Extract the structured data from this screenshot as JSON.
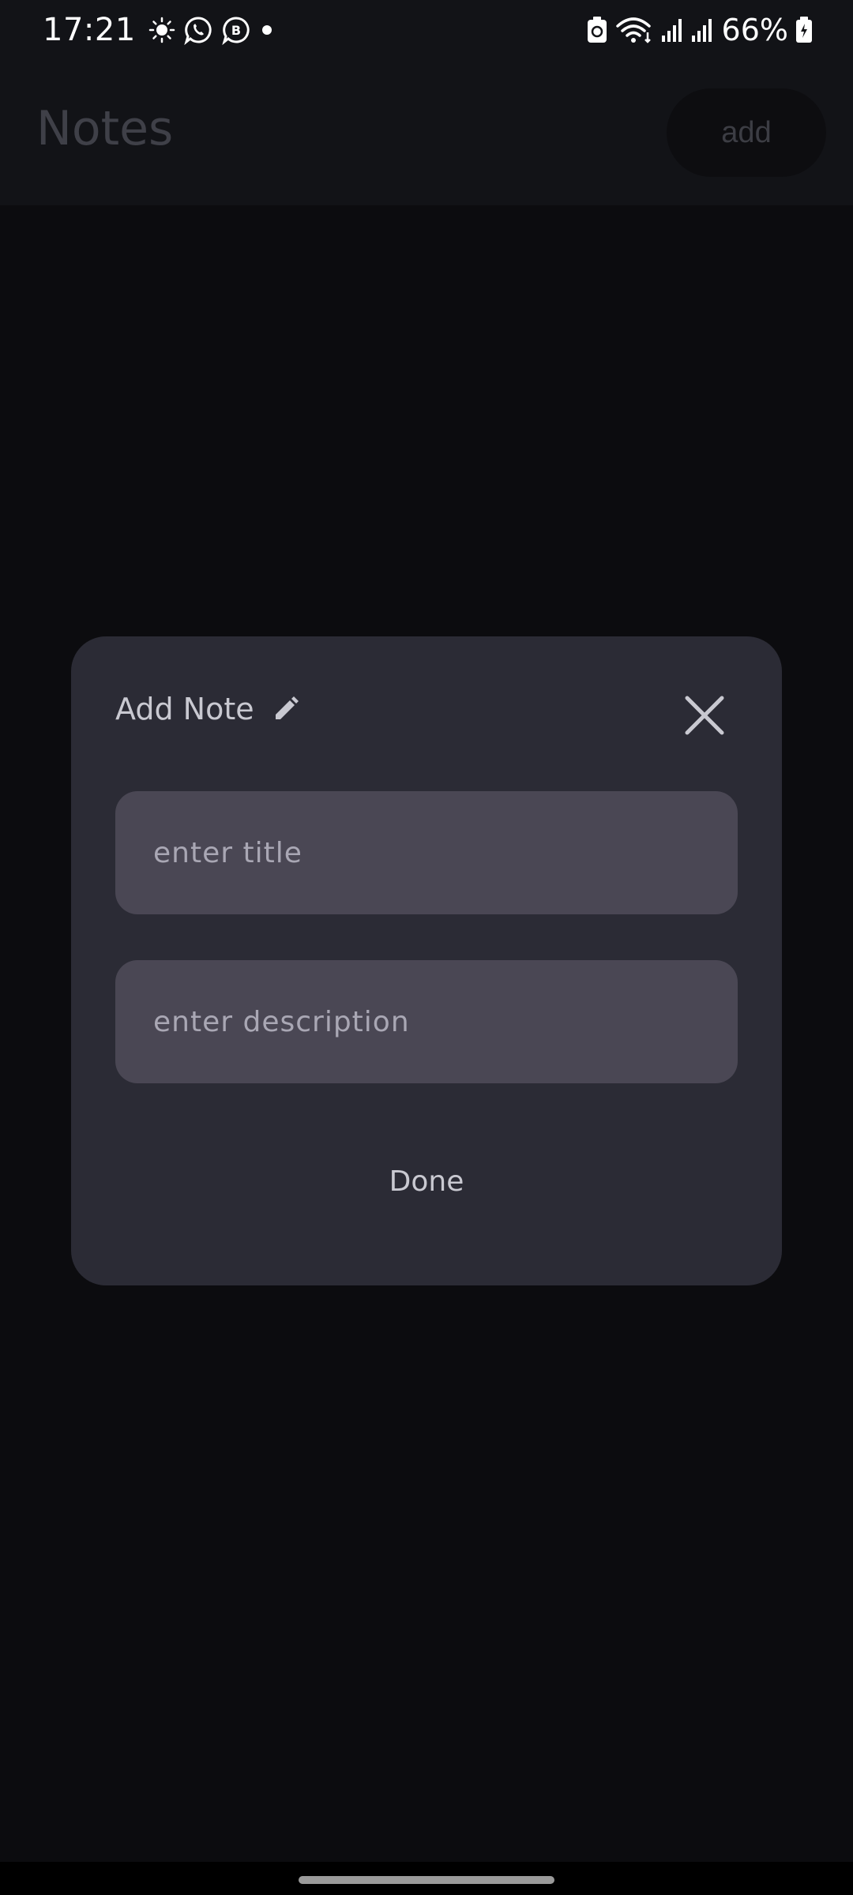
{
  "status_bar": {
    "time": "17:21",
    "battery_percent": "66%",
    "left_icons": [
      "brightness-icon",
      "whatsapp-icon",
      "whatsapp-business-icon",
      "notification-dot-icon"
    ],
    "right_icons": [
      "battery-saver-icon",
      "wifi-icon",
      "signal-icon",
      "signal-icon",
      "battery-icon"
    ]
  },
  "app_bar": {
    "title": "Notes",
    "add_label": "add"
  },
  "dialog": {
    "title": "Add Note",
    "title_icon": "pencil-icon",
    "close_icon": "close-icon",
    "title_field": {
      "placeholder": "enter title",
      "value": ""
    },
    "description_field": {
      "placeholder": "enter description",
      "value": ""
    },
    "done_label": "Done"
  },
  "colors": {
    "background": "#0c0c0f",
    "app_bar": "#121317",
    "dialog": "#2b2b35",
    "field": "#4a4754",
    "text_muted": "#c9c9d1",
    "placeholder": "#a9a7b4"
  }
}
